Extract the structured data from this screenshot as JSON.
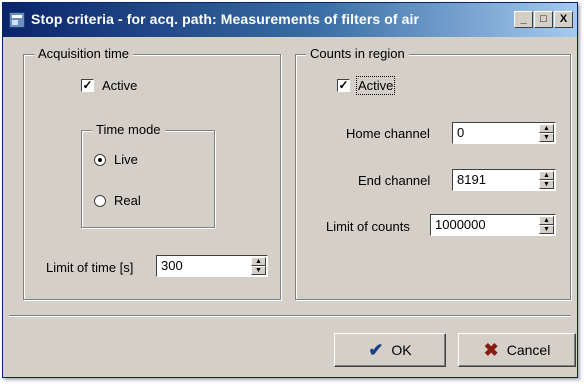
{
  "window": {
    "title": "Stop criteria - for acq. path: Measurements of filters of air",
    "caption_buttons": [
      "_",
      "□",
      "X"
    ]
  },
  "acquisition": {
    "legend": "Acquisition time",
    "active": {
      "label": "Active",
      "checked": true
    },
    "time_mode": {
      "legend": "Time mode",
      "options": [
        {
          "label": "Live",
          "selected": true
        },
        {
          "label": "Real",
          "selected": false
        }
      ]
    },
    "limit_time": {
      "label": "Limit of time [s]",
      "value": "300"
    }
  },
  "counts": {
    "legend": "Counts in region",
    "active": {
      "label": "Active",
      "checked": true
    },
    "home_channel": {
      "label": "Home channel",
      "value": "0"
    },
    "end_channel": {
      "label": "End channel",
      "value": "8191"
    },
    "limit_counts": {
      "label": "Limit of counts",
      "value": "1000000"
    }
  },
  "buttons": {
    "ok": {
      "label": "OK",
      "icon": "checkmark-icon"
    },
    "cancel": {
      "label": "Cancel",
      "icon": "x-icon"
    }
  }
}
